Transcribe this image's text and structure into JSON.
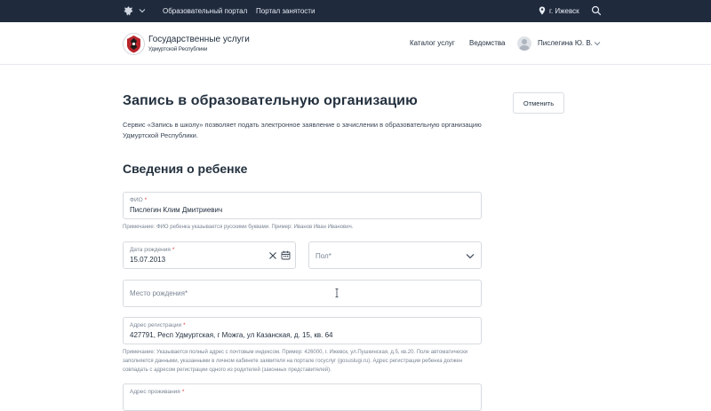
{
  "topbar": {
    "portal_link": "Образовательный портал",
    "jobs_link": "Портал занятости",
    "city": "г. Ижевск",
    "icons": [
      "emblem-icon",
      "chevron-down-icon",
      "location-pin-icon",
      "search-icon"
    ]
  },
  "header": {
    "logo_title": "Государственные услуги",
    "logo_subtitle": "Удмуртской Республики",
    "nav": {
      "catalog": "Каталог услуг",
      "departments": "Ведомства"
    },
    "user_name": "Пислегина Ю. В."
  },
  "main": {
    "title": "Запись в образовательную организацию",
    "intro": "Сервис «Запись в школу» позволяет подать электронное заявление о зачислении в образовательную организацию Удмуртской Республики.",
    "cancel_label": "Отменить",
    "section_title": "Сведения о ребенке",
    "fields": {
      "fio": {
        "label": "ФИО",
        "value": "Пислегин Клим Дмитриевич",
        "note": "Примечание: ФИО ребенка указывается русскими буквами. Пример: Иванов Иван Иванович."
      },
      "dob": {
        "label": "Дата рождения",
        "value": "15.07.2013"
      },
      "sex": {
        "label": "Пол",
        "value": ""
      },
      "birthplace": {
        "label": "Место рождения",
        "value": ""
      },
      "registration": {
        "label": "Адрес регистрации",
        "value": "427791, Респ Удмуртская, г Можга, ул Казанская, д. 15, кв. 64",
        "note": "Примечание: Указывается полный адрес с почтовым индексом. Пример: 426000, г. Ижевск, ул.Пушкинская, д.5, кв.20. Поле автоматически заполняется данными, указанными в личном кабинете заявителя на портале госуслуг (gosuslugi.ru). Адрес регистрации ребенка должен совпадать с адресом регистрации одного из родителей (законных представителей)."
      },
      "residence": {
        "label": "Адрес проживания",
        "value": ""
      }
    },
    "required_mark": "*"
  },
  "colors": {
    "topbar_bg": "#1f2a3d",
    "accent_red": "#e03c3c",
    "text_dark": "#24313f"
  }
}
